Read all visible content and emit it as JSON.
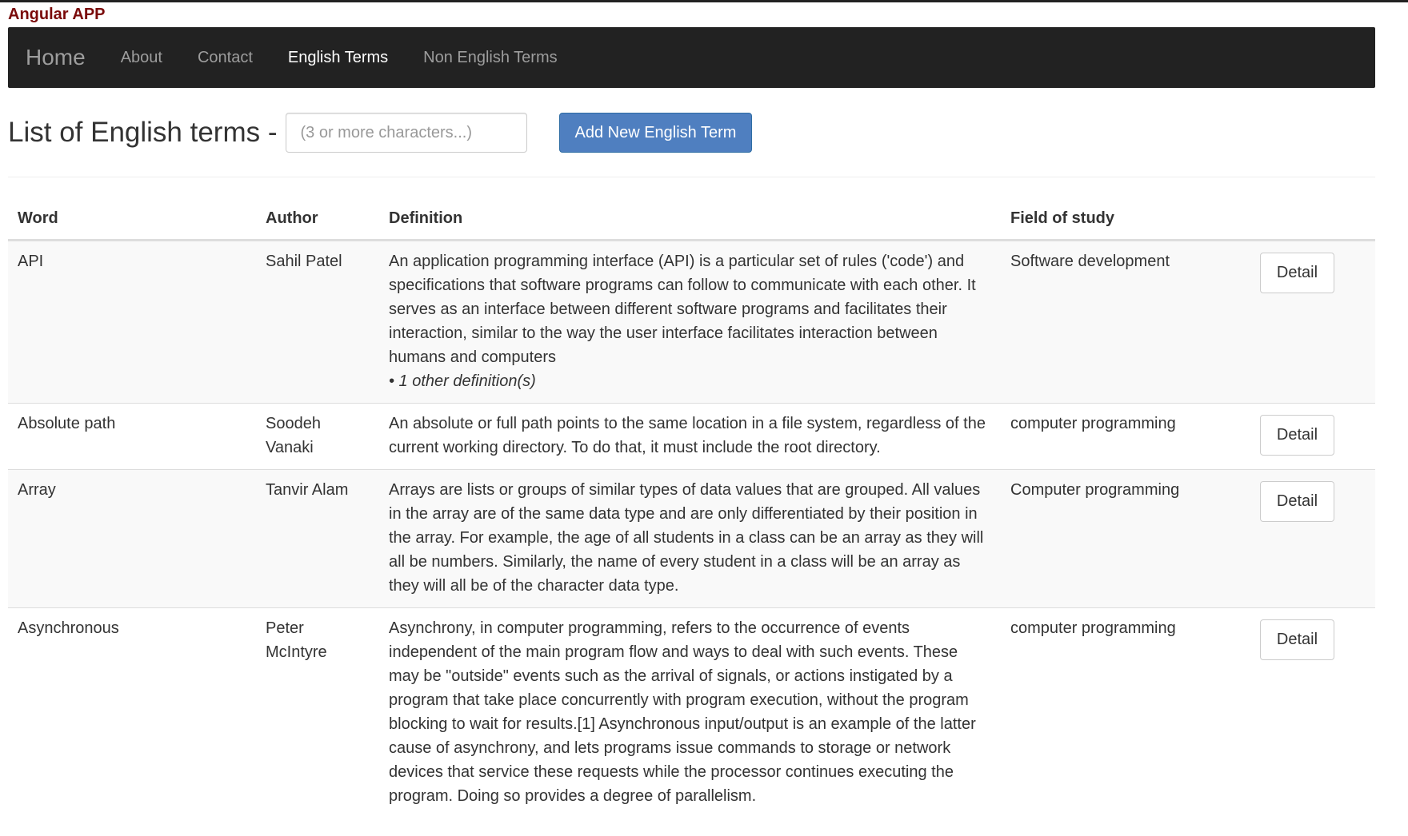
{
  "app": {
    "title": "Angular APP"
  },
  "navbar": {
    "brand": "Home",
    "links": [
      {
        "label": "About",
        "active": false
      },
      {
        "label": "Contact",
        "active": false
      },
      {
        "label": "English Terms",
        "active": true
      },
      {
        "label": "Non English Terms",
        "active": false
      }
    ]
  },
  "page": {
    "title": "List of English terms -",
    "search_placeholder": "(3 or more characters...)",
    "search_value": "",
    "add_button_label": "Add New English Term"
  },
  "table": {
    "headers": [
      "Word",
      "Author",
      "Definition",
      "Field of study",
      ""
    ],
    "detail_label": "Detail",
    "rows": [
      {
        "word": "API",
        "author": "Sahil Patel",
        "definition": "An application programming interface (API) is a particular set of rules ('code') and specifications that software programs can follow to communicate with each other. It serves as an interface between different software programs and facilitates their interaction, similar to the way the user interface facilitates interaction between humans and computers",
        "other_definitions": "• 1 other definition(s)",
        "field": "Software development"
      },
      {
        "word": "Absolute path",
        "author": "Soodeh Vanaki",
        "definition": "An absolute or full path points to the same location in a file system, regardless of the current working directory. To do that, it must include the root directory.",
        "other_definitions": "",
        "field": "computer programming"
      },
      {
        "word": "Array",
        "author": "Tanvir Alam",
        "definition": "Arrays are lists or groups of similar types of data values that are grouped. All values in the array are of the same data type and are only differentiated by their position in the array. For example, the age of all students in a class can be an array as they will all be numbers. Similarly, the name of every student in a class will be an array as they will all be of the character data type.",
        "other_definitions": "",
        "field": "Computer programming"
      },
      {
        "word": "Asynchronous",
        "author": "Peter McIntyre",
        "definition": "Asynchrony, in computer programming, refers to the occurrence of events independent of the main program flow and ways to deal with such events. These may be \"outside\" events such as the arrival of signals, or actions instigated by a program that take place concurrently with program execution, without the program blocking to wait for results.[1] Asynchronous input/output is an example of the latter cause of asynchrony, and lets programs issue commands to storage or network devices that service these requests while the processor continues executing the program. Doing so provides a degree of parallelism.",
        "other_definitions": "",
        "field": "computer programming"
      }
    ]
  },
  "colors": {
    "app_title": "#7a0a0a",
    "navbar_bg": "#222222",
    "nav_link": "#9d9d9d",
    "nav_link_active": "#ffffff",
    "primary_button": "#4f7fc0",
    "striped_row": "#f9f9f9"
  }
}
